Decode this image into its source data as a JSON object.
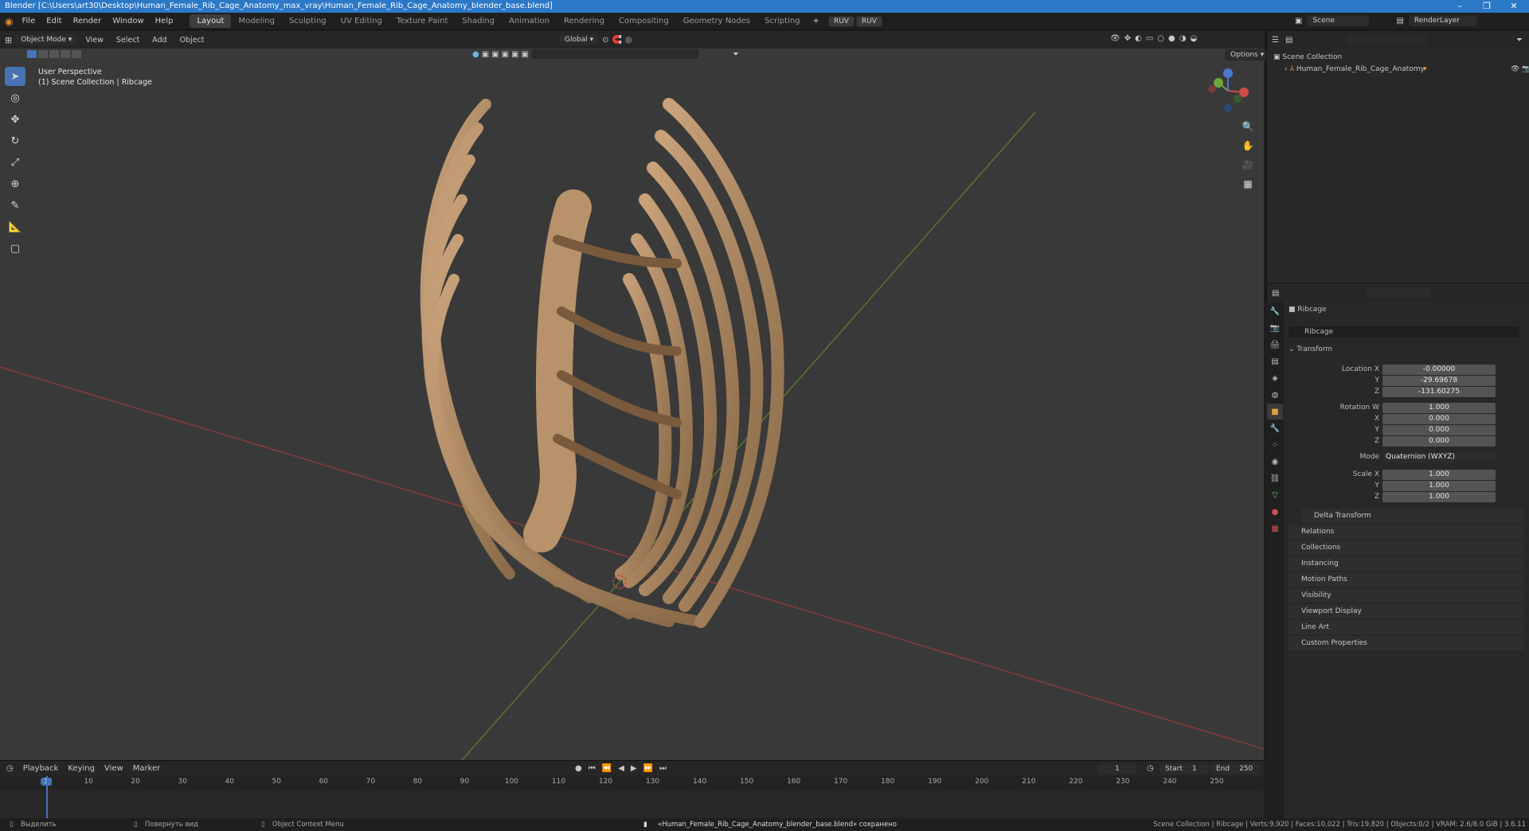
{
  "window": {
    "title": "Blender [C:\\Users\\art30\\Desktop\\Human_Female_Rib_Cage_Anatomy_max_vray\\Human_Female_Rib_Cage_Anatomy_blender_base.blend]",
    "controls": [
      "–",
      "❐",
      "✕"
    ]
  },
  "menubar": {
    "items": [
      "File",
      "Edit",
      "Render",
      "Window",
      "Help"
    ],
    "workspaces": [
      "Layout",
      "Modeling",
      "Sculpting",
      "UV Editing",
      "Texture Paint",
      "Shading",
      "Animation",
      "Rendering",
      "Compositing",
      "Geometry Nodes",
      "Scripting"
    ],
    "active_workspace": "Layout",
    "ruv": [
      "RUV",
      "RUV"
    ],
    "scene_label": "Scene",
    "renderlayer_label": "RenderLayer"
  },
  "viewport_header": {
    "mode": "Object Mode",
    "menus": [
      "View",
      "Select",
      "Add",
      "Object"
    ],
    "orientation": "Global",
    "options": "Options"
  },
  "viewport": {
    "perspective": "User Perspective",
    "collection": "(1) Scene Collection | Ribcage"
  },
  "outliner": {
    "root": "Scene Collection",
    "items": [
      "Human_Female_Rib_Cage_Anatomy"
    ]
  },
  "properties": {
    "object_name": "Ribcage",
    "data_name": "Ribcage",
    "transform_label": "Transform",
    "location_label": "Location X",
    "location": [
      "-0.00000",
      "-29.69678",
      "-131.60275"
    ],
    "rotation_label": "Rotation W",
    "rotation": [
      "1.000",
      "0.000",
      "0.000",
      "0.000"
    ],
    "mode_label": "Mode",
    "mode_value": "Quaternion (WXYZ)",
    "scale_label": "Scale X",
    "scale": [
      "1.000",
      "1.000",
      "1.000"
    ],
    "axis_labels": [
      "X",
      "Y",
      "Z",
      "W"
    ],
    "panels": [
      "Delta Transform",
      "Relations",
      "Collections",
      "Instancing",
      "Motion Paths",
      "Visibility",
      "Viewport Display",
      "Line Art",
      "Custom Properties"
    ]
  },
  "timeline": {
    "menus": [
      "Playback",
      "Keying",
      "View",
      "Marker"
    ],
    "current_frame": "1",
    "start_label": "Start",
    "start": "1",
    "end_label": "End",
    "end": "250",
    "ticks": [
      "1",
      "10",
      "20",
      "30",
      "40",
      "50",
      "60",
      "70",
      "80",
      "90",
      "100",
      "110",
      "120",
      "130",
      "140",
      "150",
      "160",
      "170",
      "180",
      "190",
      "200",
      "210",
      "220",
      "230",
      "240",
      "250"
    ]
  },
  "statusbar": {
    "select": "Выделить",
    "rotate": "Повернуть вид",
    "context": "Object Context Menu",
    "saved": "«Human_Female_Rib_Cage_Anatomy_blender_base.blend» сохранено",
    "stats": "Scene Collection | Ribcage | Verts:9,920 | Faces:10,022 | Tris:19,820 | Objects:0/2 | VRAM: 2.6/8.0 GiB | 3.6.11"
  }
}
